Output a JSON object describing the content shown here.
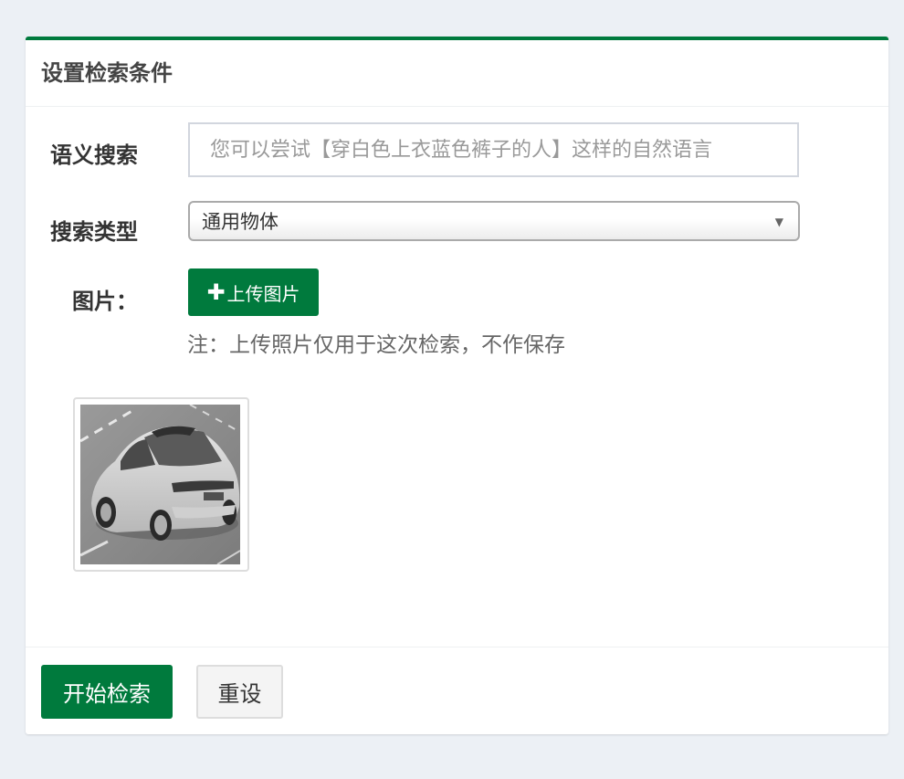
{
  "panel": {
    "title": "设置检索条件"
  },
  "form": {
    "semantic_label": "语义搜索",
    "semantic_placeholder": "您可以尝试【穿白色上衣蓝色裤子的人】这样的自然语言",
    "type_label": "搜索类型",
    "type_selected": "通用物体",
    "image_label": "图片：",
    "upload_label": "上传图片",
    "upload_note": "注：上传照片仅用于这次检索，不作保存"
  },
  "footer": {
    "search_label": "开始检索",
    "reset_label": "重设"
  },
  "colors": {
    "accent": "#007a3d",
    "background": "#ecf0f5"
  },
  "icons": {
    "upload": "plus-icon",
    "select": "caret-down-icon"
  }
}
